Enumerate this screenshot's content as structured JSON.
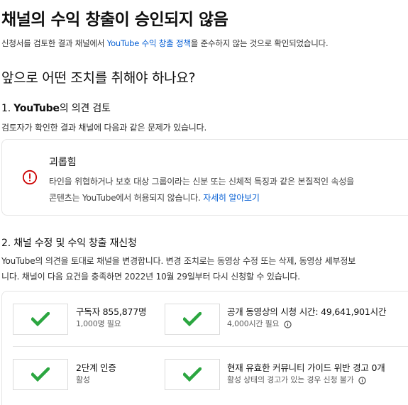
{
  "header": {
    "title": "채널의 수익 창출이 승인되지 않음",
    "lead_prefix": "신청서를 검토한 결과 채널에서 ",
    "lead_link": "YouTube 수익 창출 정책",
    "lead_suffix": "을 준수하지 않는 것으로 확인되었습니다."
  },
  "next_steps": {
    "heading": "앞으로 어떤 조치를 취해야 하나요?"
  },
  "review": {
    "step_number": "1.",
    "step_brand": "YouTube",
    "step_rest": "의 의견 검토",
    "description": "검토자가 확인한 결과 채널에 다음과 같은 문제가 있습니다.",
    "issue": {
      "icon": "warning-circle-icon",
      "title": "괴롭힘",
      "body_line1": "타인을 위협하거나 보호 대상 그룹이라는 신분 또는 신체적 특징과 같은 본질적인 속성을",
      "body_line2_prefix": "콘텐츠는 YouTube에서 허용되지 않습니다. ",
      "body_link": "자세히 알아보기"
    }
  },
  "reapply": {
    "step_number": "2.",
    "step_text": "채널 수정 및 수익 창출 재신청",
    "para_line1": "YouTube의 의견을 토대로 채널을 변경합니다. 변경 조치로는 동영상 수정 또는 삭제, 동영상 세부정보",
    "para_line2": "니다. 채널이 다음 요건을 충족하면 2022년 10월 29일부터 다시 신청할 수 있습니다.",
    "requirements": [
      {
        "title": "구독자 855,877명",
        "sub": "1,000명 필요",
        "info": false
      },
      {
        "title": "공개 동영상의 시청 시간: 49,641,901시간",
        "sub": "4,000시간 필요",
        "info": true
      },
      {
        "title": "2단계 인증",
        "sub": "활성",
        "info": false
      },
      {
        "title": "현재 유효한 커뮤니티 가이드 위반 경고 0개",
        "sub": "활성 상태의 경고가 있는 경우 신청 불가",
        "info": true
      }
    ]
  },
  "colors": {
    "link": "#065fd4",
    "check": "#2ba640",
    "warning": "#cc0000"
  }
}
